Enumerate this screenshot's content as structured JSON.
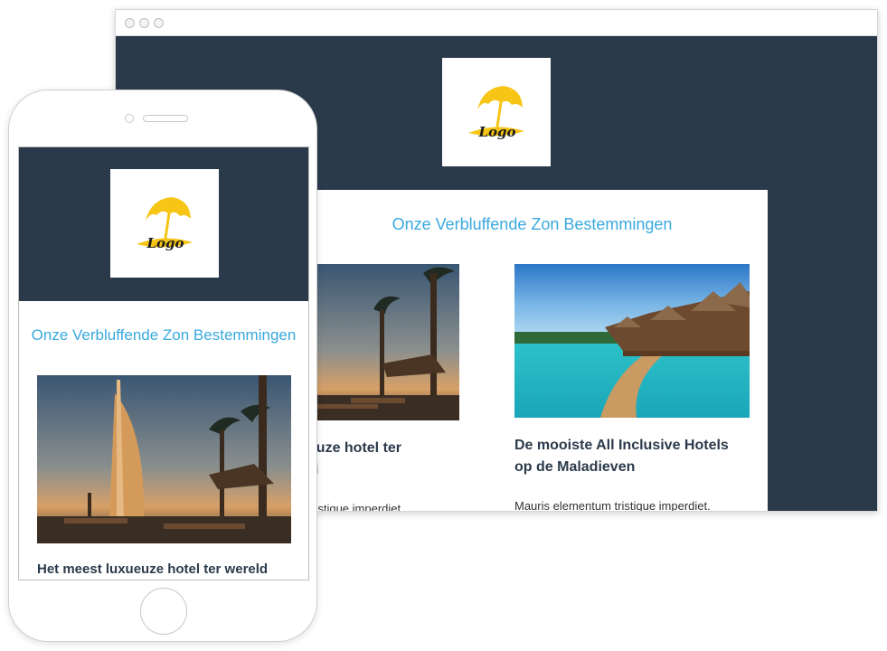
{
  "desktop": {
    "logo_text": "Logo",
    "title": "Onze Verbluffende Zon Bestemmingen",
    "articles": [
      {
        "heading_line1": "luxueuze hotel ter",
        "heading_line2": "Dubai",
        "excerpt": "ntum tristique imperdiet."
      },
      {
        "heading_line1": "De mooiste All Inclusive Hotels",
        "heading_line2": "op de Maladieven",
        "excerpt": "Mauris elementum tristique imperdiet."
      }
    ]
  },
  "mobile": {
    "logo_text": "Logo",
    "title": "Onze Verbluffende Zon Bestemmingen",
    "article_heading": "Het meest luxueuze hotel ter wereld"
  },
  "colors": {
    "header_bg": "#2b3a4b",
    "accent": "#3aa9de",
    "logo_yellow": "#f7c515"
  }
}
